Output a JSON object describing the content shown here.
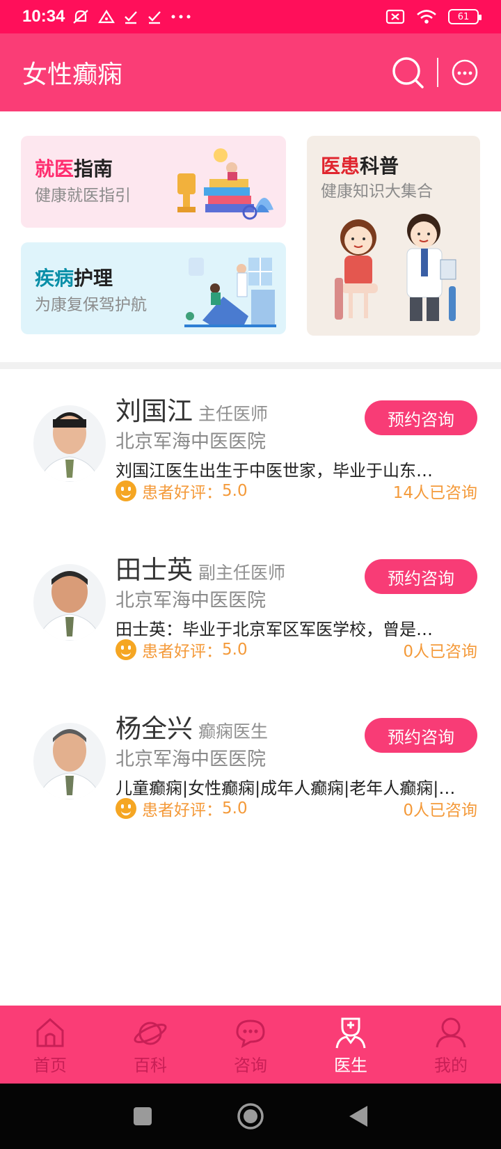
{
  "status_bar": {
    "time": "10:34",
    "battery": "61"
  },
  "header": {
    "title": "女性癫痫"
  },
  "banners": {
    "guide": {
      "title_highlight": "就医",
      "title_rest": "指南",
      "subtitle": "健康就医指引"
    },
    "care": {
      "title_highlight": "疾病",
      "title_rest": "护理",
      "subtitle": "为康复保驾护航"
    },
    "science": {
      "title_highlight": "医患",
      "title_rest": "科普",
      "subtitle": "健康知识大集合"
    }
  },
  "doctors": [
    {
      "name": "刘国江",
      "title": "主任医师",
      "hospital": "北京军海中医医院",
      "description": "刘国江医生出生于中医世家，毕业于山东…",
      "rating_label": "患者好评：",
      "rating": "5.0",
      "consult_count": "14人已咨询",
      "button": "预约咨询"
    },
    {
      "name": "田士英",
      "title": "副主任医师",
      "hospital": "北京军海中医医院",
      "description": "田士英：毕业于北京军区军医学校，曾是…",
      "rating_label": "患者好评：",
      "rating": "5.0",
      "consult_count": "0人已咨询",
      "button": "预约咨询"
    },
    {
      "name": "杨全兴",
      "title": "癫痫医生",
      "hospital": "北京军海中医医院",
      "description": "儿童癫痫|女性癫痫|成年人癫痫|老年人癫痫|…",
      "rating_label": "患者好评：",
      "rating": "5.0",
      "consult_count": "0人已咨询",
      "button": "预约咨询"
    }
  ],
  "bottom_nav": [
    {
      "label": "首页",
      "icon": "home-icon"
    },
    {
      "label": "百科",
      "icon": "planet-icon"
    },
    {
      "label": "咨询",
      "icon": "chat-icon"
    },
    {
      "label": "医生",
      "icon": "doctor-icon",
      "active": true
    },
    {
      "label": "我的",
      "icon": "user-icon"
    }
  ],
  "colors": {
    "status_bar": "#ff0f5a",
    "header": "#fa3d76",
    "accent": "#f83c76",
    "rating": "#f49a3a"
  }
}
